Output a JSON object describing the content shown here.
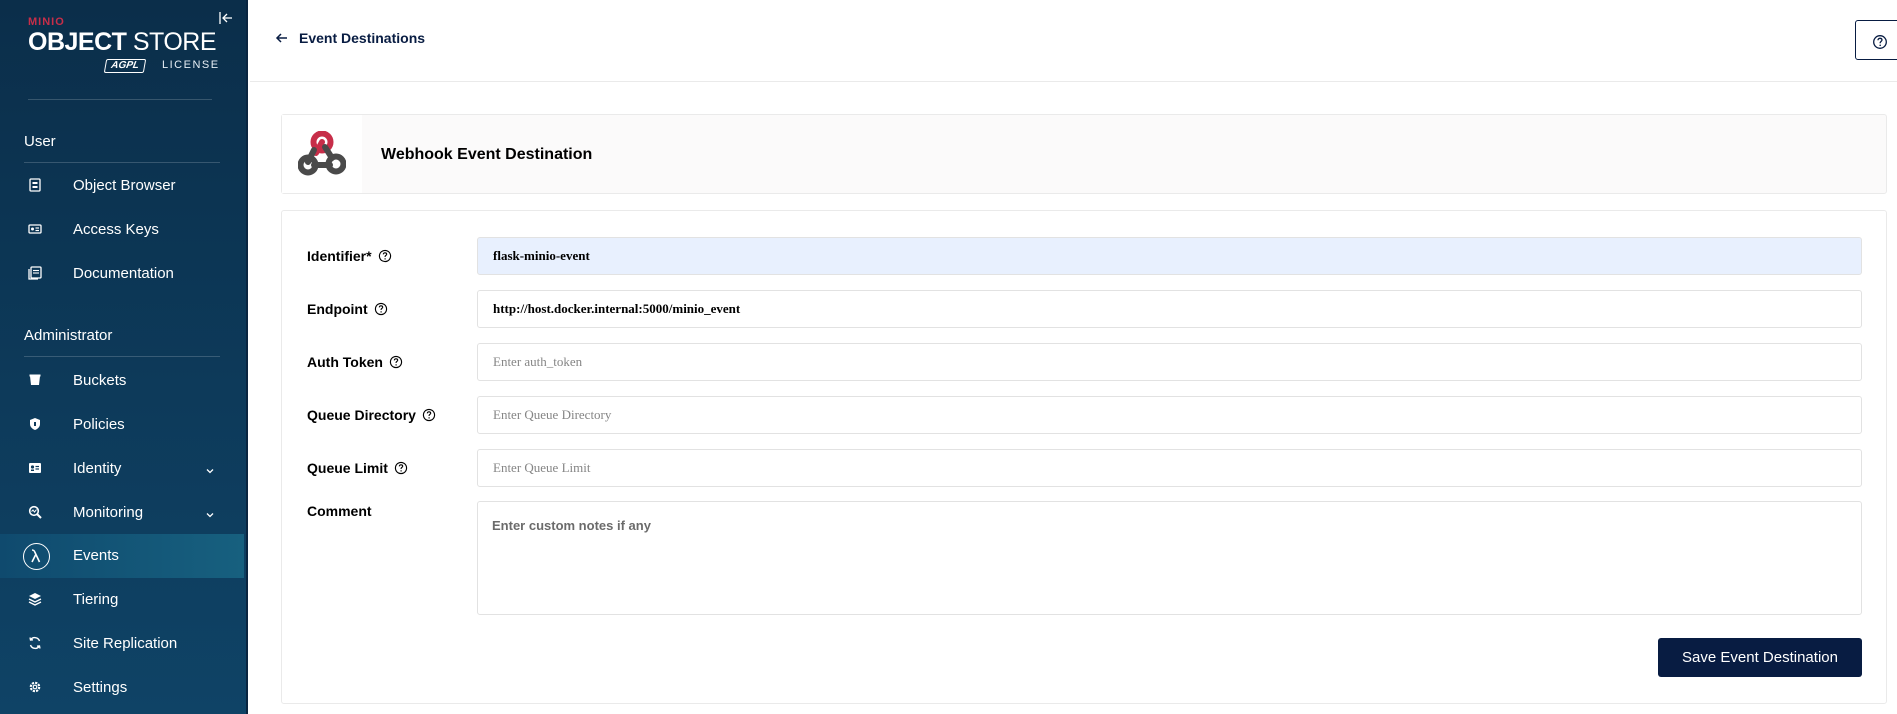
{
  "brand": {
    "vendor": "MINIO",
    "title_bold": "OBJECT",
    "title_light": "STORE",
    "badge": "AGPL",
    "license": "LICENSE"
  },
  "sidebar": {
    "user_section": "User",
    "admin_section": "Administrator",
    "user_items": [
      {
        "label": "Object Browser",
        "icon": "object-browser-icon"
      },
      {
        "label": "Access Keys",
        "icon": "access-keys-icon"
      },
      {
        "label": "Documentation",
        "icon": "documentation-icon"
      }
    ],
    "admin_items": [
      {
        "label": "Buckets",
        "icon": "bucket-icon"
      },
      {
        "label": "Policies",
        "icon": "shield-icon"
      },
      {
        "label": "Identity",
        "icon": "identity-icon",
        "expandable": true
      },
      {
        "label": "Monitoring",
        "icon": "monitoring-icon",
        "expandable": true
      },
      {
        "label": "Events",
        "icon": "lambda-icon",
        "active": true
      },
      {
        "label": "Tiering",
        "icon": "tiering-icon"
      },
      {
        "label": "Site Replication",
        "icon": "replication-icon"
      },
      {
        "label": "Settings",
        "icon": "gear-icon"
      }
    ]
  },
  "header": {
    "back_label": "Event Destinations"
  },
  "title_card": {
    "title": "Webhook Event Destination",
    "icon": "webhook-icon"
  },
  "form": {
    "identifier": {
      "label": "Identifier*",
      "value": "flask-minio-event"
    },
    "endpoint": {
      "label": "Endpoint",
      "value": "http://host.docker.internal:5000/minio_event"
    },
    "auth_token": {
      "label": "Auth Token",
      "placeholder": "Enter auth_token"
    },
    "queue_directory": {
      "label": "Queue Directory",
      "placeholder": "Enter Queue Directory"
    },
    "queue_limit": {
      "label": "Queue Limit",
      "placeholder": "Enter Queue Limit"
    },
    "comment": {
      "label": "Comment",
      "placeholder": "Enter custom notes if any"
    },
    "save_label": "Save Event Destination"
  },
  "colors": {
    "sidebar_bg": "#0b2e4a",
    "primary": "#081c42",
    "brand_red": "#c72e49",
    "autofill_bg": "#e8f0fe"
  }
}
